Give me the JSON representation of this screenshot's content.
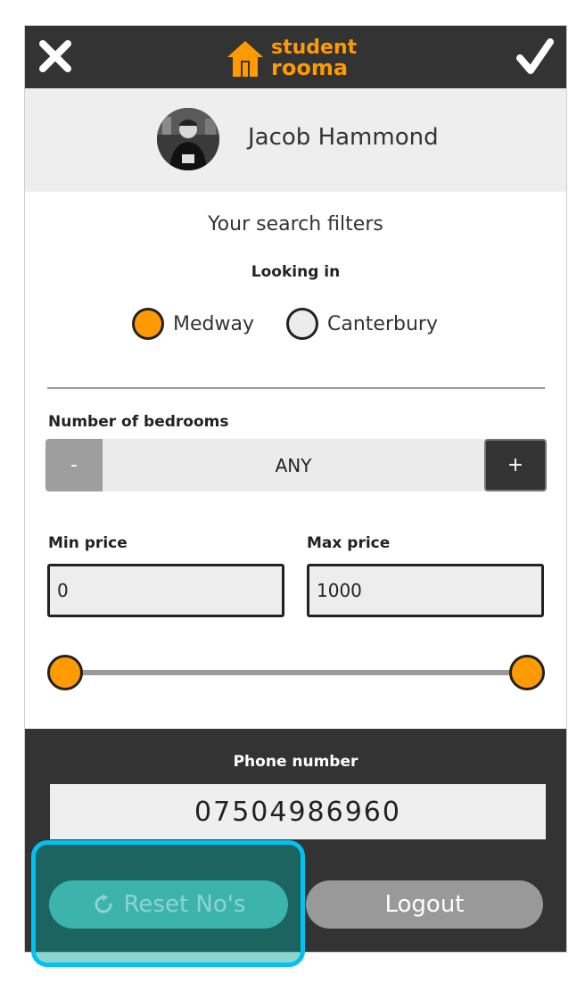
{
  "app": {
    "logo_line1": "student",
    "logo_line2": "rooma",
    "brand_color": "#ff9a00"
  },
  "header": {
    "close_icon": "close-icon",
    "confirm_icon": "checkmark-icon"
  },
  "profile": {
    "name": "Jacob Hammond"
  },
  "filters": {
    "title": "Your search filters",
    "looking_in_label": "Looking in",
    "locations": [
      {
        "label": "Medway",
        "selected": true
      },
      {
        "label": "Canterbury",
        "selected": false
      }
    ],
    "bedrooms_label": "Number of bedrooms",
    "bedrooms_minus": "-",
    "bedrooms_value": "ANY",
    "bedrooms_plus": "+",
    "min_price_label": "Min price",
    "min_price_value": "0",
    "max_price_label": "Max price",
    "max_price_value": "1000"
  },
  "contact": {
    "phone_label": "Phone number",
    "phone_value": "07504986960"
  },
  "actions": {
    "reset_label": "Reset No's",
    "logout_label": "Logout"
  }
}
